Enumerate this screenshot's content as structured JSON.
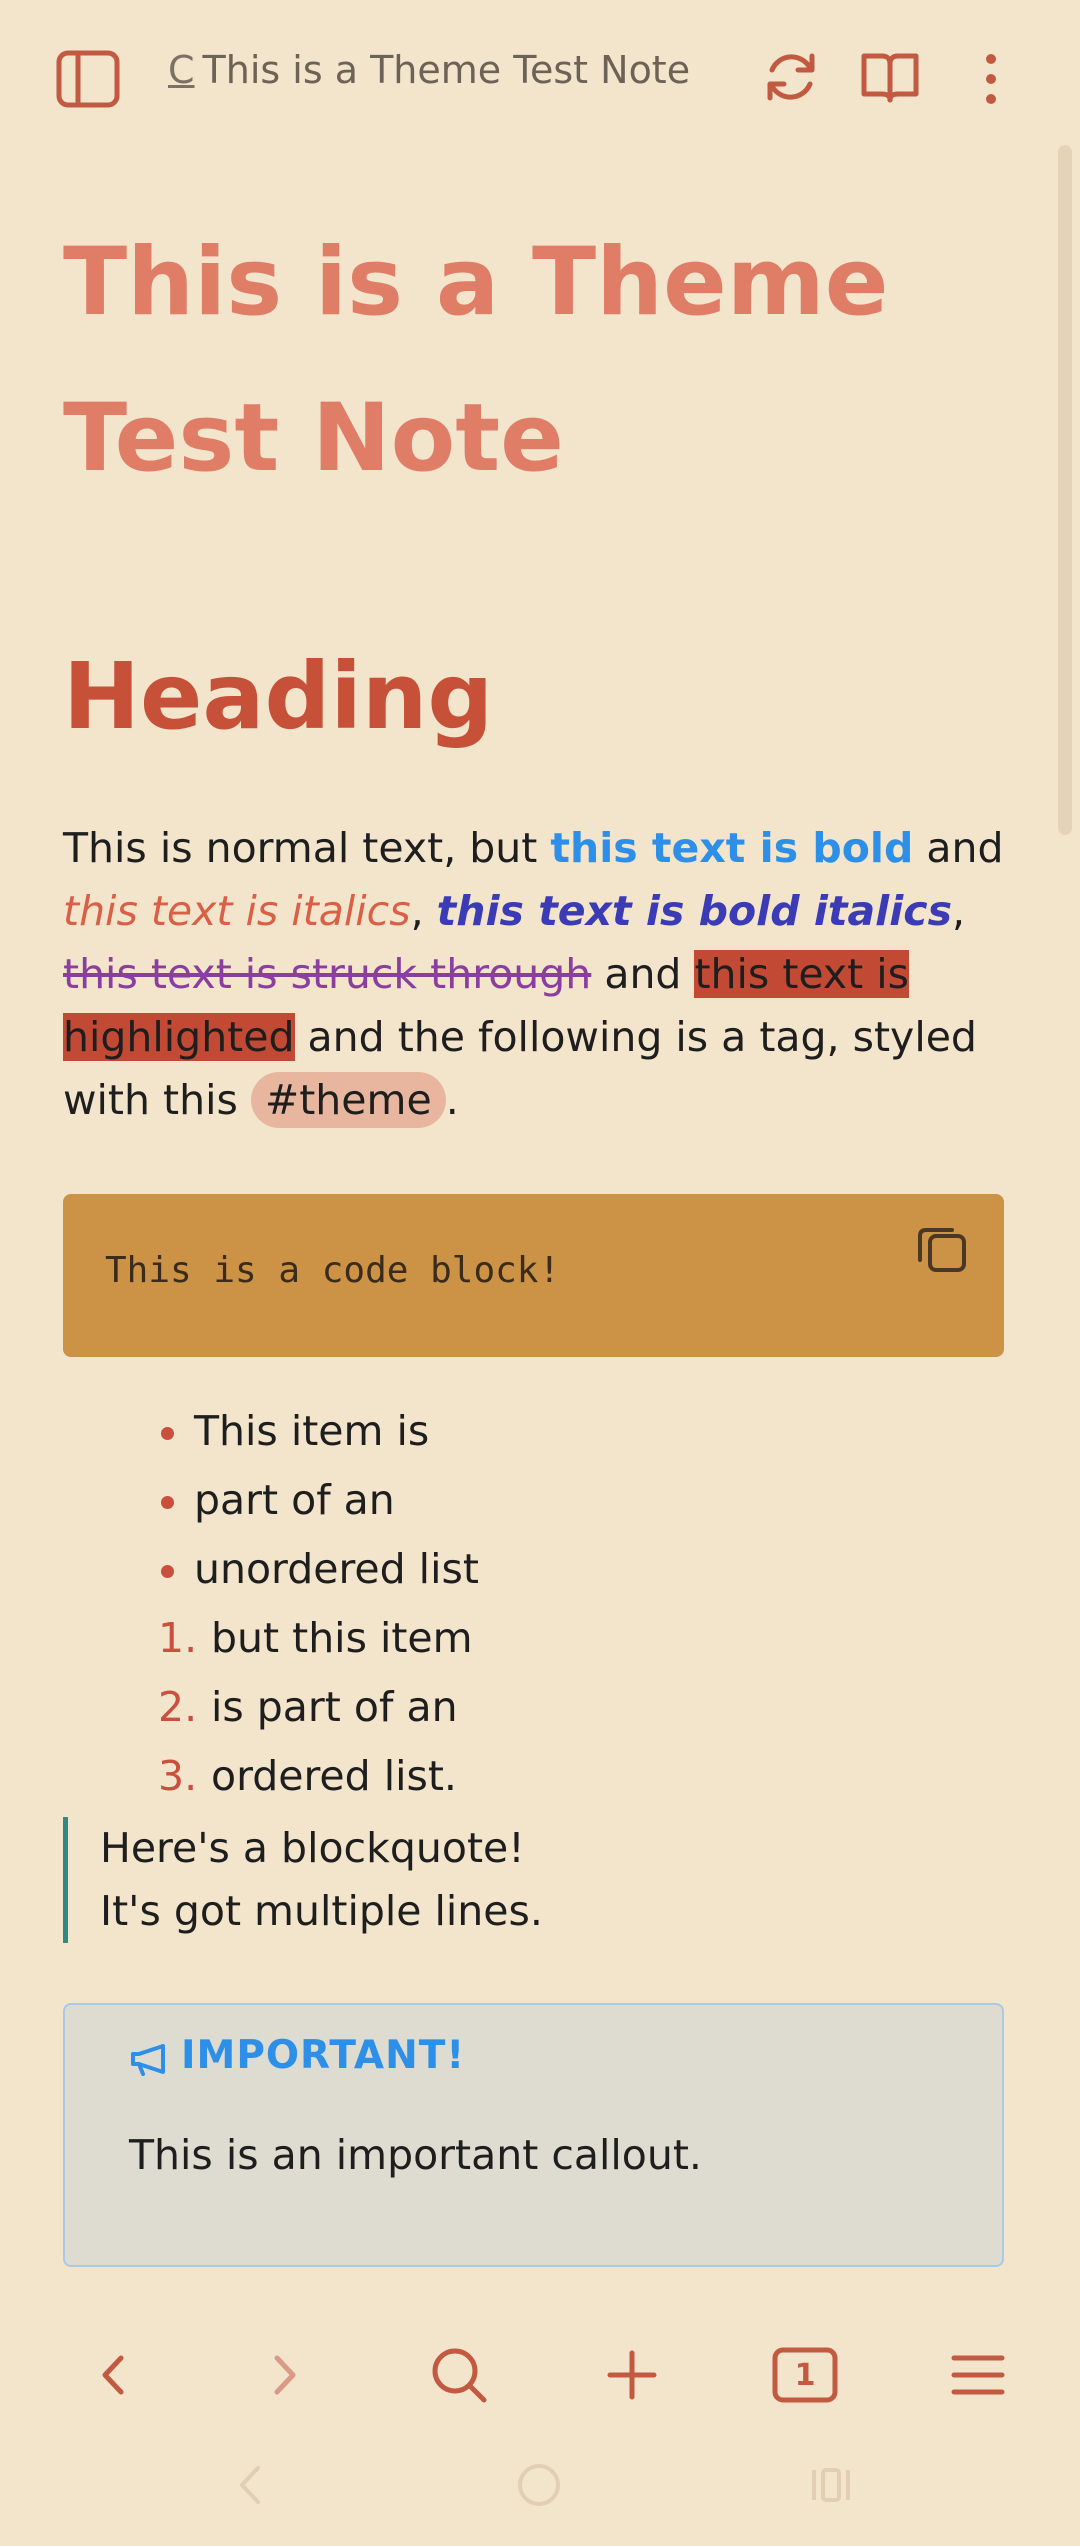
{
  "topbar": {
    "title_prefix": "C",
    "title": "This is a Theme Test Note",
    "icons": [
      "sidebar-toggle-icon",
      "sync-icon",
      "reading-view-icon",
      "more-vert-icon"
    ]
  },
  "note": {
    "title": "This is a Theme Test Note",
    "heading": "Heading",
    "para": {
      "t1": "This is normal text, but ",
      "bold": "this text is bold",
      "t2": " and ",
      "italics": "this text is italics",
      "t3": ", ",
      "bolditalics": "this text is bold italics",
      "t4": ", ",
      "strike": "this text is struck through",
      "t5": " and ",
      "highlight": "this text is highlighted",
      "t6": " and the following is a tag, styled with this ",
      "tag": "#theme",
      "t7": "."
    },
    "code": "This is a code block!",
    "unordered": [
      "This item is",
      "part of an",
      "unordered list"
    ],
    "ordered": [
      {
        "num": "1.",
        "text": "but this item"
      },
      {
        "num": "2.",
        "text": "is part of an"
      },
      {
        "num": "3.",
        "text": "ordered list."
      }
    ],
    "quote": [
      "Here's a blockquote!",
      "It's got multiple lines."
    ],
    "callout": {
      "title": "IMPORTANT!",
      "body": "This is an important callout."
    }
  },
  "bottom_nav": {
    "tab_count": "1",
    "icons": [
      "back-icon",
      "forward-icon",
      "search-icon",
      "new-note-icon",
      "tabs-icon",
      "menu-icon"
    ]
  },
  "colors": {
    "background": "#f3e4cc",
    "accent": "#c25a42",
    "title": "#e07d67",
    "bold": "#2e8fe8",
    "code_bg": "#cc9246"
  }
}
